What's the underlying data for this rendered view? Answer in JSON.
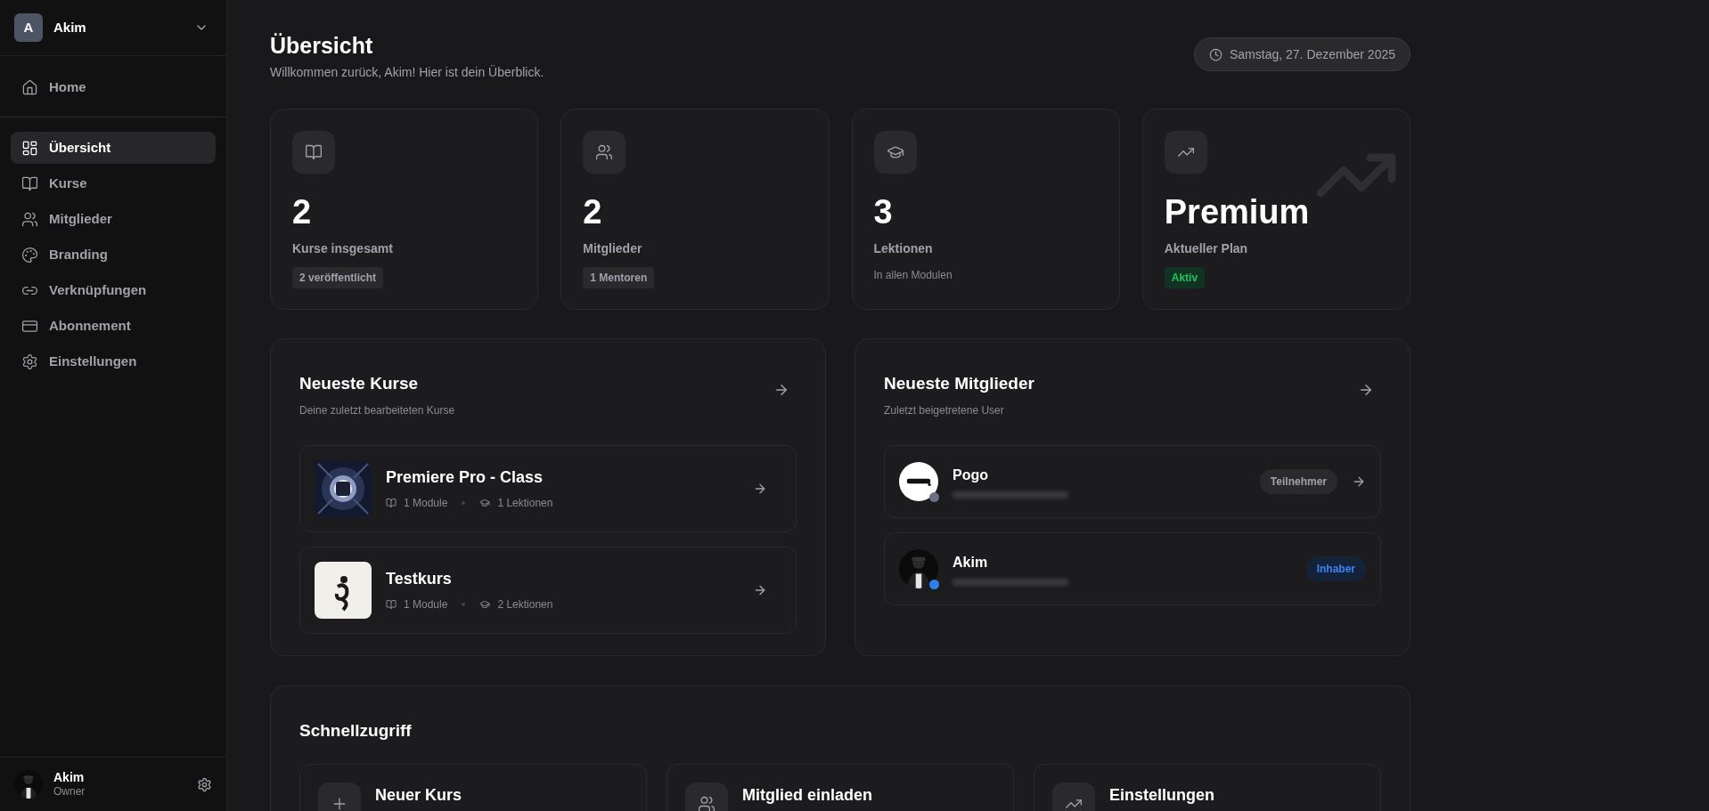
{
  "workspace": {
    "initial": "A",
    "name": "Akim"
  },
  "nav_top": [
    {
      "label": "Home",
      "selected": false
    }
  ],
  "nav": [
    {
      "label": "Übersicht",
      "selected": true
    },
    {
      "label": "Kurse",
      "selected": false
    },
    {
      "label": "Mitglieder",
      "selected": false
    },
    {
      "label": "Branding",
      "selected": false
    },
    {
      "label": "Verknüpfungen",
      "selected": false
    },
    {
      "label": "Abonnement",
      "selected": false
    },
    {
      "label": "Einstellungen",
      "selected": false
    }
  ],
  "user": {
    "name": "Akim",
    "role": "Owner"
  },
  "header": {
    "title": "Übersicht",
    "subtitle": "Willkommen zurück, Akim! Hier ist dein Überblick.",
    "date": "Samstag, 27. Dezember 2025"
  },
  "stats": [
    {
      "value": "2",
      "label": "Kurse insgesamt",
      "footer": {
        "kind": "tag",
        "text": "2 veröffentlicht"
      },
      "watermark": false
    },
    {
      "value": "2",
      "label": "Mitglieder",
      "footer": {
        "kind": "tag",
        "text": "1 Mentoren"
      },
      "watermark": false
    },
    {
      "value": "3",
      "label": "Lektionen",
      "footer": {
        "kind": "note",
        "text": "In allen Modulen"
      },
      "watermark": false
    },
    {
      "value": "Premium",
      "label": "Aktueller Plan",
      "footer": {
        "kind": "success",
        "text": "Aktiv"
      },
      "watermark": true
    }
  ],
  "courses_panel": {
    "title": "Neueste Kurse",
    "subtitle": "Deine zuletzt bearbeiteten Kurse",
    "courses": [
      {
        "title": "Premiere Pro - Class",
        "modules": "1 Module",
        "lessons": "1 Lektionen"
      },
      {
        "title": "Testkurs",
        "modules": "1 Module",
        "lessons": "2 Lektionen"
      }
    ]
  },
  "members_panel": {
    "title": "Neueste Mitglieder",
    "subtitle": "Zuletzt beigetretene User",
    "members": [
      {
        "name": "Pogo",
        "color": "#6b7280",
        "role": {
          "kind": "neutral",
          "text": "Teilnehmer"
        },
        "link": true
      },
      {
        "name": "Akim",
        "color": "#2f80ed",
        "role": {
          "kind": "owner",
          "text": "Inhaber"
        },
        "link": false
      }
    ]
  },
  "quick": {
    "title": "Schnellzugriff",
    "actions": [
      {
        "label": "Neuer Kurs"
      },
      {
        "label": "Mitglied einladen"
      },
      {
        "label": "Einstellungen"
      }
    ]
  }
}
